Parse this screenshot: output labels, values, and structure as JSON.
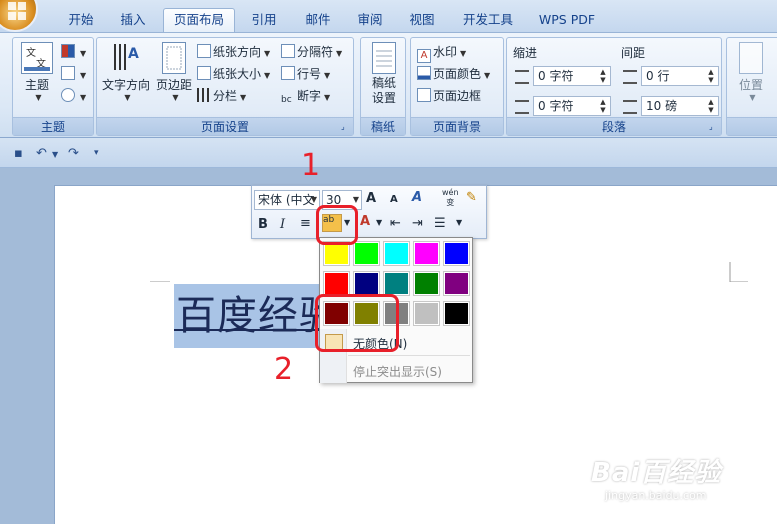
{
  "tabs": [
    "开始",
    "插入",
    "页面布局",
    "引用",
    "邮件",
    "审阅",
    "视图",
    "开发工具",
    "WPS PDF"
  ],
  "active_tab": "页面布局",
  "ribbon": {
    "theme_group": {
      "label": "主题",
      "theme_button": "主题"
    },
    "page_setup_group": {
      "label": "页面设置",
      "text_direction": "文字方向",
      "margins": "页边距",
      "orientation": "纸张方向",
      "size": "纸张大小",
      "columns": "分栏",
      "breaks": "分隔符",
      "line_numbers": "行号",
      "hyphenation": "断字"
    },
    "draft_group": {
      "label": "稿纸",
      "button": "稿纸\n设置"
    },
    "page_background_group": {
      "label": "页面背景",
      "watermark": "水印",
      "page_color": "页面颜色",
      "page_borders": "页面边框"
    },
    "paragraph_group": {
      "label": "段落",
      "indent_label": "缩进",
      "spacing_label": "间距",
      "indent_left": "0 字符",
      "indent_right": "0 字符",
      "spacing_before": "0 行",
      "spacing_after": "10 磅"
    },
    "arrange_group": {
      "position": "位置"
    }
  },
  "mini_toolbar": {
    "font_name": "宋体 (中文",
    "font_size": "30",
    "grow_font": "A",
    "shrink_font": "A",
    "bold": "B",
    "italic": "I",
    "phonetic": "wén\n变"
  },
  "color_panel": {
    "swatches": [
      "#ffff00",
      "#00ff00",
      "#00ffff",
      "#ff00ff",
      "#0000ff",
      "#ff0000",
      "#000080",
      "#008080",
      "#008000",
      "#800080",
      "#800000",
      "#808000",
      "#808080",
      "#c0c0c0",
      "#000000"
    ],
    "no_color": "无颜色(N)",
    "stop_highlight": "停止突出显示(S)"
  },
  "document": {
    "selected_text": "百度经验"
  },
  "annotations": {
    "step1": "1",
    "step2": "2"
  },
  "watermark": {
    "brand": "Bai百经验",
    "site": "jingyan.baidu.com"
  },
  "colors": {
    "annotation_red": "#e8202a",
    "highlight_orange": "#f4c04a"
  }
}
